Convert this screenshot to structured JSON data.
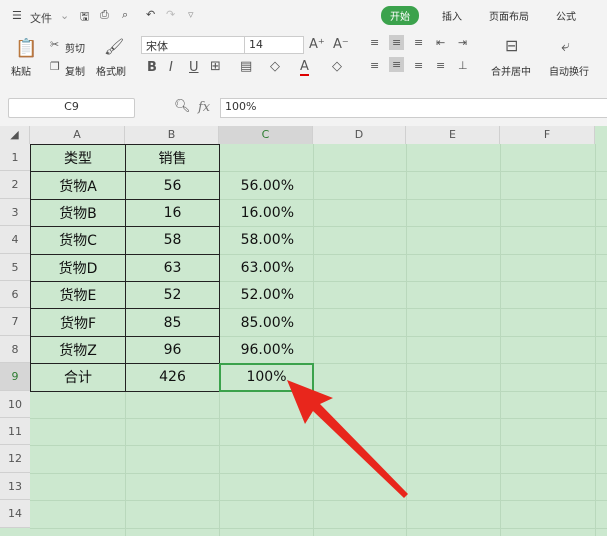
{
  "quick": {
    "menu": "文件"
  },
  "tabs": [
    "开始",
    "插入",
    "页面布局",
    "公式"
  ],
  "ribbon": {
    "paste": "粘贴",
    "cut": "剪切",
    "copy": "复制",
    "format_painter": "格式刷",
    "font": "宋体",
    "size": "14",
    "merge": "合并居中",
    "wrap": "自动换行"
  },
  "formula": {
    "cell_ref": "C9",
    "fx": "fx",
    "value": "100%"
  },
  "columns": [
    "A",
    "B",
    "C",
    "D",
    "E",
    "F"
  ],
  "rows": [
    "1",
    "2",
    "3",
    "4",
    "5",
    "6",
    "7",
    "8",
    "9",
    "10",
    "11",
    "12",
    "13",
    "14"
  ],
  "table": [
    [
      "类型",
      "销售",
      ""
    ],
    [
      "货物A",
      "56",
      "56.00%"
    ],
    [
      "货物B",
      "16",
      "16.00%"
    ],
    [
      "货物C",
      "58",
      "58.00%"
    ],
    [
      "货物D",
      "63",
      "63.00%"
    ],
    [
      "货物E",
      "52",
      "52.00%"
    ],
    [
      "货物F",
      "85",
      "85.00%"
    ],
    [
      "货物Z",
      "96",
      "96.00%"
    ],
    [
      "合计",
      "426",
      "100%"
    ]
  ],
  "colors": {
    "accent": "#3ba24c",
    "sheet": "#cce8cf",
    "arrow": "#e8261c"
  }
}
